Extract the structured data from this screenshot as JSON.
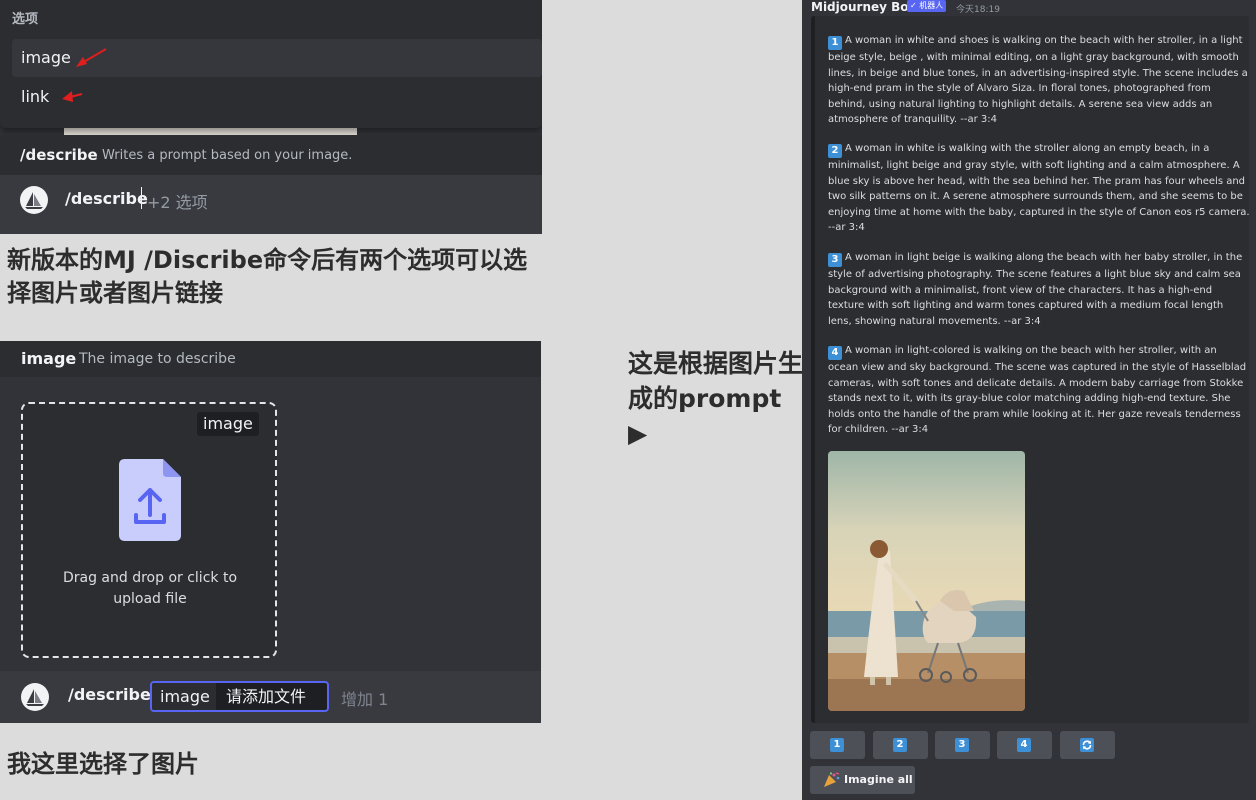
{
  "panel_options": {
    "menu_title": "选项",
    "options": [
      "image",
      "link"
    ],
    "command_name": "/describe",
    "command_desc": "Writes a prompt based on your image.",
    "input_command": "/describe",
    "input_more": "+2 选项"
  },
  "captions": {
    "top": "新版本的MJ /Discribe命令后有两个选项可以选择图片或者图片链接",
    "bottom": "我这里选择了图片",
    "right": "这是根据图片生成的prompt ▶"
  },
  "panel_upload": {
    "option_name": "image",
    "option_desc": "The image to describe",
    "drop_tag": "image",
    "drop_text": "Drag and drop or click to upload file",
    "input_command": "/describe",
    "field_name": "image",
    "field_value": "请添加文件",
    "add_more": "增加 1"
  },
  "bot_message": {
    "bot_name": "Midjourney Bot",
    "badge": "✓ 机器人",
    "timestamp": "今天18:19",
    "prompts": [
      {
        "num": "1",
        "text": "A woman in white and shoes is walking on the beach with her stroller, in a light beige style, beige , with minimal editing, on a light gray background, with smooth lines, in beige and blue tones, in an advertising-inspired style. The scene includes a high-end pram in the style of Alvaro Siza. In floral tones, photographed from behind, using natural lighting to highlight details. A serene sea view adds an atmosphere of tranquility. --ar 3:4"
      },
      {
        "num": "2",
        "text": "A woman in white is walking with the stroller along an empty beach, in a minimalist, light beige and gray style, with soft lighting and a calm atmosphere. A blue sky is above her head, with the sea behind her. The pram has four wheels and two silk patterns on it. A serene atmosphere surrounds them, and she seems to be enjoying time at home with the baby, captured in the style of Canon eos r5 camera. --ar 3:4"
      },
      {
        "num": "3",
        "text": "A woman in light beige is walking along the beach with her baby stroller, in the style of advertising photography. The scene features a light blue sky and calm sea background with a minimalist, front view of the characters. It has a high-end texture with soft lighting and warm tones captured with a medium focal length lens, showing natural movements. --ar 3:4"
      },
      {
        "num": "4",
        "text": "A woman in light-colored is walking on the beach with her stroller, with an ocean view and sky background. The scene was captured in the style of Hasselblad cameras, with soft tones and delicate details. A modern baby carriage from Stokke stands next to it, with its gray-blue color matching adding high-end texture. She holds onto the handle of the pram while looking at it. Her gaze reveals tenderness for children. --ar 3:4"
      }
    ],
    "buttons": [
      "1",
      "2",
      "3",
      "4"
    ],
    "refresh_icon": "refresh-icon",
    "imagine_all_label": "Imagine all",
    "imagine_all_icon": "party-popper-icon"
  },
  "colors": {
    "discord_dark": "#313338",
    "discord_darker": "#2b2d31",
    "blurple": "#5865f2",
    "number_badge": "#3d8fd6",
    "annotation_red": "#e01e1e"
  }
}
